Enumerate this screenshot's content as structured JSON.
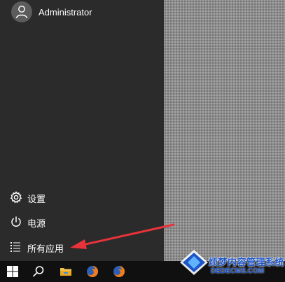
{
  "user": {
    "name": "Administrator",
    "icon": "user-icon"
  },
  "menu": {
    "settings": {
      "label": "设置",
      "icon": "gear-icon"
    },
    "power": {
      "label": "电源",
      "icon": "power-icon"
    },
    "all_apps": {
      "label": "所有应用",
      "icon": "list-icon"
    }
  },
  "taskbar": {
    "items": [
      {
        "icon": "windows-start-icon"
      },
      {
        "icon": "search-icon"
      },
      {
        "icon": "file-explorer-icon"
      },
      {
        "icon": "firefox-icon"
      },
      {
        "icon": "firefox-icon"
      }
    ]
  },
  "watermark": {
    "title": "烦梦内容管理系统",
    "url": "DEDECMS.COM"
  },
  "colors": {
    "menu_bg": "#2b2b2b",
    "taskbar_bg": "#101010",
    "arrow": "#e8333a",
    "watermark_blue": "#1e55c8"
  }
}
